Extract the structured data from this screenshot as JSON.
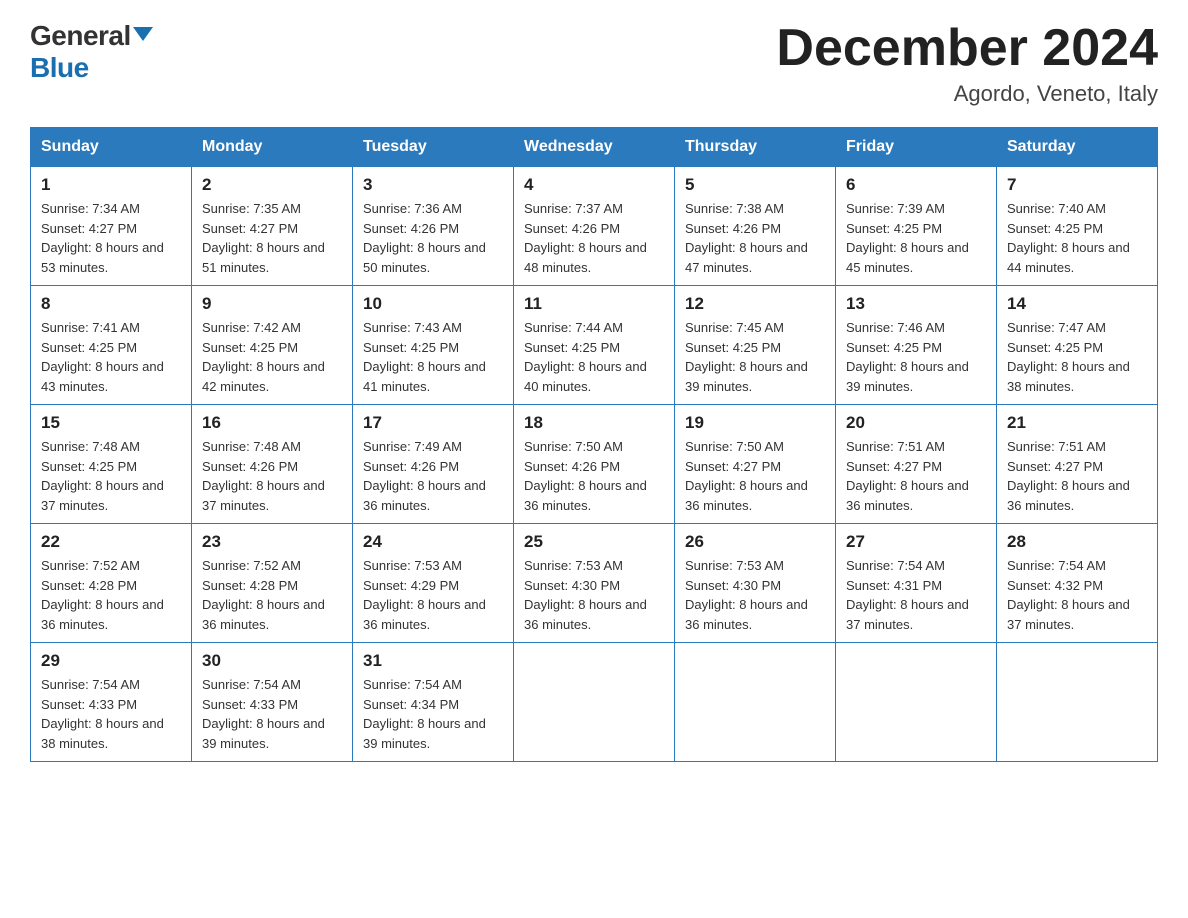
{
  "header": {
    "logo_general": "General",
    "logo_blue": "Blue",
    "month_title": "December 2024",
    "location": "Agordo, Veneto, Italy"
  },
  "days_of_week": [
    "Sunday",
    "Monday",
    "Tuesday",
    "Wednesday",
    "Thursday",
    "Friday",
    "Saturday"
  ],
  "weeks": [
    [
      {
        "day": "1",
        "sunrise": "Sunrise: 7:34 AM",
        "sunset": "Sunset: 4:27 PM",
        "daylight": "Daylight: 8 hours and 53 minutes."
      },
      {
        "day": "2",
        "sunrise": "Sunrise: 7:35 AM",
        "sunset": "Sunset: 4:27 PM",
        "daylight": "Daylight: 8 hours and 51 minutes."
      },
      {
        "day": "3",
        "sunrise": "Sunrise: 7:36 AM",
        "sunset": "Sunset: 4:26 PM",
        "daylight": "Daylight: 8 hours and 50 minutes."
      },
      {
        "day": "4",
        "sunrise": "Sunrise: 7:37 AM",
        "sunset": "Sunset: 4:26 PM",
        "daylight": "Daylight: 8 hours and 48 minutes."
      },
      {
        "day": "5",
        "sunrise": "Sunrise: 7:38 AM",
        "sunset": "Sunset: 4:26 PM",
        "daylight": "Daylight: 8 hours and 47 minutes."
      },
      {
        "day": "6",
        "sunrise": "Sunrise: 7:39 AM",
        "sunset": "Sunset: 4:25 PM",
        "daylight": "Daylight: 8 hours and 45 minutes."
      },
      {
        "day": "7",
        "sunrise": "Sunrise: 7:40 AM",
        "sunset": "Sunset: 4:25 PM",
        "daylight": "Daylight: 8 hours and 44 minutes."
      }
    ],
    [
      {
        "day": "8",
        "sunrise": "Sunrise: 7:41 AM",
        "sunset": "Sunset: 4:25 PM",
        "daylight": "Daylight: 8 hours and 43 minutes."
      },
      {
        "day": "9",
        "sunrise": "Sunrise: 7:42 AM",
        "sunset": "Sunset: 4:25 PM",
        "daylight": "Daylight: 8 hours and 42 minutes."
      },
      {
        "day": "10",
        "sunrise": "Sunrise: 7:43 AM",
        "sunset": "Sunset: 4:25 PM",
        "daylight": "Daylight: 8 hours and 41 minutes."
      },
      {
        "day": "11",
        "sunrise": "Sunrise: 7:44 AM",
        "sunset": "Sunset: 4:25 PM",
        "daylight": "Daylight: 8 hours and 40 minutes."
      },
      {
        "day": "12",
        "sunrise": "Sunrise: 7:45 AM",
        "sunset": "Sunset: 4:25 PM",
        "daylight": "Daylight: 8 hours and 39 minutes."
      },
      {
        "day": "13",
        "sunrise": "Sunrise: 7:46 AM",
        "sunset": "Sunset: 4:25 PM",
        "daylight": "Daylight: 8 hours and 39 minutes."
      },
      {
        "day": "14",
        "sunrise": "Sunrise: 7:47 AM",
        "sunset": "Sunset: 4:25 PM",
        "daylight": "Daylight: 8 hours and 38 minutes."
      }
    ],
    [
      {
        "day": "15",
        "sunrise": "Sunrise: 7:48 AM",
        "sunset": "Sunset: 4:25 PM",
        "daylight": "Daylight: 8 hours and 37 minutes."
      },
      {
        "day": "16",
        "sunrise": "Sunrise: 7:48 AM",
        "sunset": "Sunset: 4:26 PM",
        "daylight": "Daylight: 8 hours and 37 minutes."
      },
      {
        "day": "17",
        "sunrise": "Sunrise: 7:49 AM",
        "sunset": "Sunset: 4:26 PM",
        "daylight": "Daylight: 8 hours and 36 minutes."
      },
      {
        "day": "18",
        "sunrise": "Sunrise: 7:50 AM",
        "sunset": "Sunset: 4:26 PM",
        "daylight": "Daylight: 8 hours and 36 minutes."
      },
      {
        "day": "19",
        "sunrise": "Sunrise: 7:50 AM",
        "sunset": "Sunset: 4:27 PM",
        "daylight": "Daylight: 8 hours and 36 minutes."
      },
      {
        "day": "20",
        "sunrise": "Sunrise: 7:51 AM",
        "sunset": "Sunset: 4:27 PM",
        "daylight": "Daylight: 8 hours and 36 minutes."
      },
      {
        "day": "21",
        "sunrise": "Sunrise: 7:51 AM",
        "sunset": "Sunset: 4:27 PM",
        "daylight": "Daylight: 8 hours and 36 minutes."
      }
    ],
    [
      {
        "day": "22",
        "sunrise": "Sunrise: 7:52 AM",
        "sunset": "Sunset: 4:28 PM",
        "daylight": "Daylight: 8 hours and 36 minutes."
      },
      {
        "day": "23",
        "sunrise": "Sunrise: 7:52 AM",
        "sunset": "Sunset: 4:28 PM",
        "daylight": "Daylight: 8 hours and 36 minutes."
      },
      {
        "day": "24",
        "sunrise": "Sunrise: 7:53 AM",
        "sunset": "Sunset: 4:29 PM",
        "daylight": "Daylight: 8 hours and 36 minutes."
      },
      {
        "day": "25",
        "sunrise": "Sunrise: 7:53 AM",
        "sunset": "Sunset: 4:30 PM",
        "daylight": "Daylight: 8 hours and 36 minutes."
      },
      {
        "day": "26",
        "sunrise": "Sunrise: 7:53 AM",
        "sunset": "Sunset: 4:30 PM",
        "daylight": "Daylight: 8 hours and 36 minutes."
      },
      {
        "day": "27",
        "sunrise": "Sunrise: 7:54 AM",
        "sunset": "Sunset: 4:31 PM",
        "daylight": "Daylight: 8 hours and 37 minutes."
      },
      {
        "day": "28",
        "sunrise": "Sunrise: 7:54 AM",
        "sunset": "Sunset: 4:32 PM",
        "daylight": "Daylight: 8 hours and 37 minutes."
      }
    ],
    [
      {
        "day": "29",
        "sunrise": "Sunrise: 7:54 AM",
        "sunset": "Sunset: 4:33 PM",
        "daylight": "Daylight: 8 hours and 38 minutes."
      },
      {
        "day": "30",
        "sunrise": "Sunrise: 7:54 AM",
        "sunset": "Sunset: 4:33 PM",
        "daylight": "Daylight: 8 hours and 39 minutes."
      },
      {
        "day": "31",
        "sunrise": "Sunrise: 7:54 AM",
        "sunset": "Sunset: 4:34 PM",
        "daylight": "Daylight: 8 hours and 39 minutes."
      },
      null,
      null,
      null,
      null
    ]
  ]
}
